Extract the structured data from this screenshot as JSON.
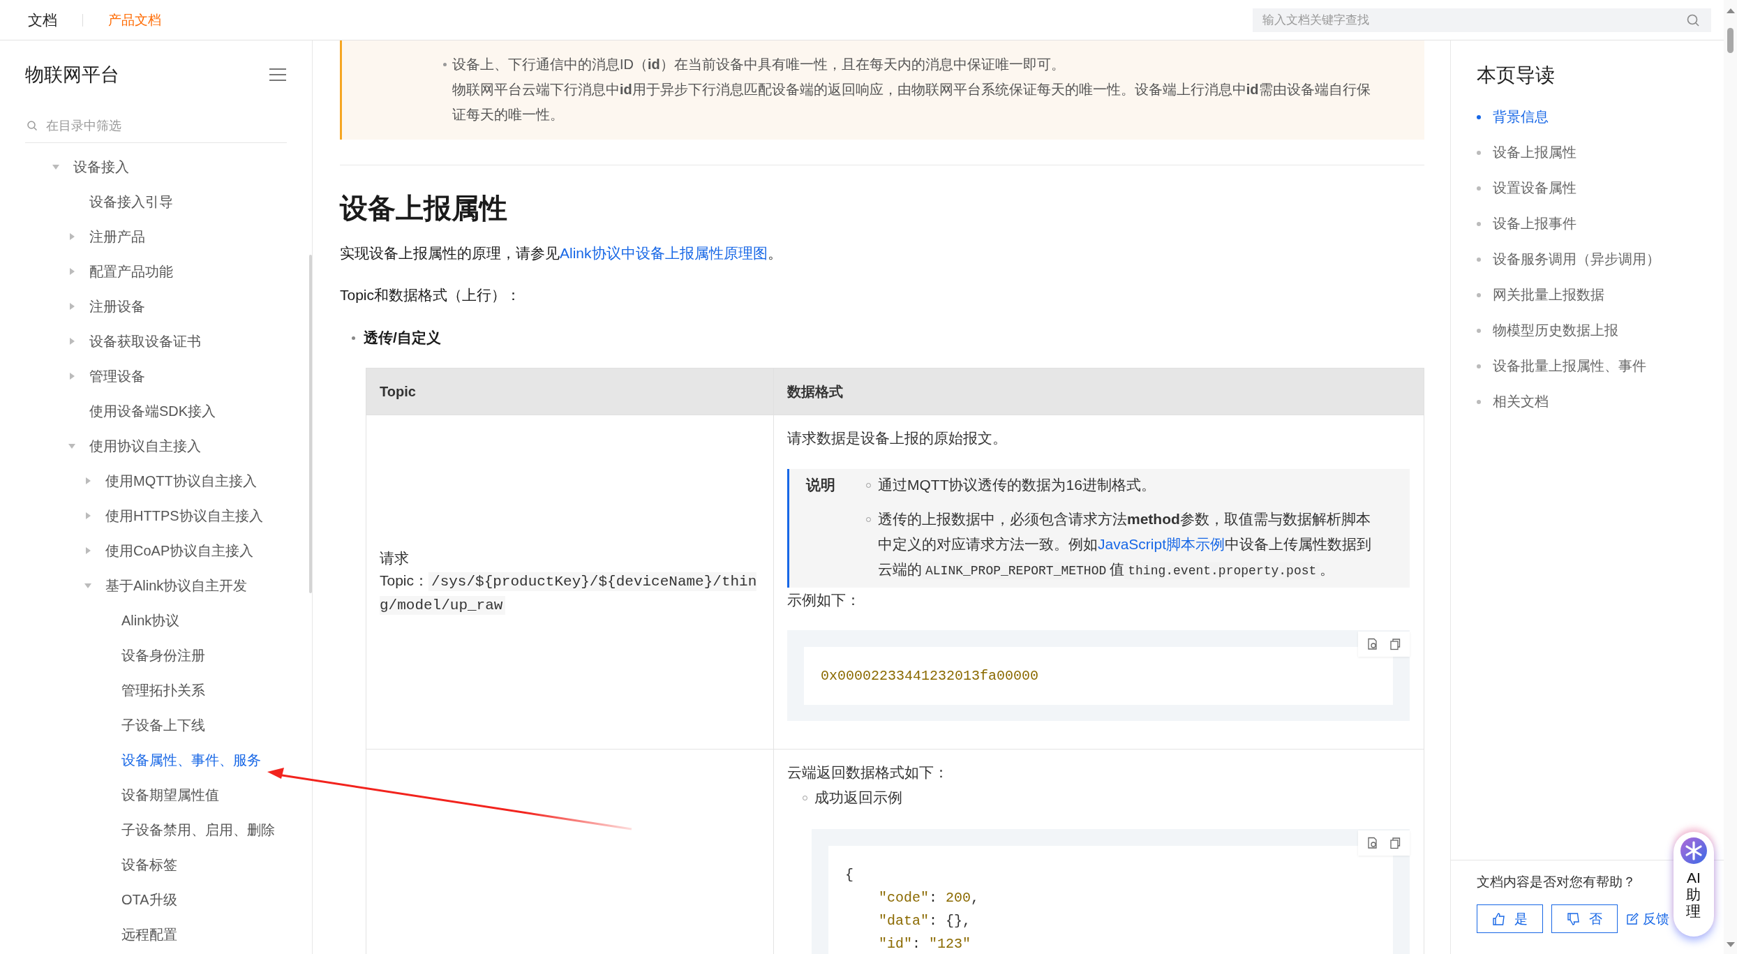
{
  "topbar": {
    "home": "文档",
    "section": "产品文档",
    "search": {
      "placeholder": "输入文档关键字查找"
    }
  },
  "sidebar": {
    "title": "物联网平台",
    "filter": {
      "placeholder": "在目录中筛选"
    },
    "tree": [
      {
        "label": "设备接入",
        "expanded": true,
        "selected": false,
        "children": [
          {
            "label": "设备接入引导",
            "selected": false
          },
          {
            "label": "注册产品",
            "expanded": false,
            "selected": false
          },
          {
            "label": "配置产品功能",
            "expanded": false,
            "selected": false
          },
          {
            "label": "注册设备",
            "expanded": false,
            "selected": false
          },
          {
            "label": "设备获取设备证书",
            "expanded": false,
            "selected": false
          },
          {
            "label": "管理设备",
            "expanded": false,
            "selected": false
          },
          {
            "label": "使用设备端SDK接入",
            "selected": false
          },
          {
            "label": "使用协议自主接入",
            "expanded": true,
            "selected": false,
            "children": [
              {
                "label": "使用MQTT协议自主接入",
                "expanded": false,
                "selected": false
              },
              {
                "label": "使用HTTPS协议自主接入",
                "expanded": false,
                "selected": false
              },
              {
                "label": "使用CoAP协议自主接入",
                "expanded": false,
                "selected": false
              },
              {
                "label": "基于Alink协议自主开发",
                "expanded": true,
                "selected": false,
                "children": [
                  {
                    "label": "Alink协议",
                    "selected": false
                  },
                  {
                    "label": "设备身份注册",
                    "selected": false
                  },
                  {
                    "label": "管理拓扑关系",
                    "selected": false
                  },
                  {
                    "label": "子设备上下线",
                    "selected": false
                  },
                  {
                    "label": "设备属性、事件、服务",
                    "selected": true
                  },
                  {
                    "label": "设备期望属性值",
                    "selected": false
                  },
                  {
                    "label": "子设备禁用、启用、删除",
                    "selected": false
                  },
                  {
                    "label": "设备标签",
                    "selected": false
                  },
                  {
                    "label": "OTA升级",
                    "selected": false
                  },
                  {
                    "label": "远程配置",
                    "selected": false
                  }
                ]
              }
            ]
          }
        ]
      }
    ]
  },
  "article": {
    "notice": {
      "items": [
        {
          "paragraphs": [
            "设备上、下行通信中的消息ID（**id**）在当前设备中具有唯一性，且在每天内的消息中保证唯一即可。",
            "物联网平台云端下行消息中**id**用于异步下行消息匹配设备端的返回响应，由物联网平台系统保证每天的唯一性。设备端上行消息中**id**需由设备端自行保证每天的唯一性。"
          ]
        }
      ]
    },
    "heading": "设备上报属性",
    "intro": [
      {
        "kind": "text",
        "text": "实现设备上报属性的原理，请参见"
      },
      {
        "kind": "link",
        "text": "Alink协议中设备上报属性原理图"
      },
      {
        "kind": "text",
        "text": "。"
      }
    ],
    "format_label": "Topic和数据格式（上行）：",
    "bullet": "透传/自定义",
    "table": {
      "columns": [
        "Topic",
        "数据格式"
      ],
      "rows": [
        {
          "left": {
            "label": "请求",
            "topic_label": "Topic：",
            "topic": "/sys/${productKey}/${deviceName}/thing/model/up_raw"
          },
          "right": [
            {
              "kind": "para",
              "parts": [
                {
                  "kind": "text",
                  "text": "请求数据是设备上报的原始报文。"
                }
              ]
            },
            {
              "kind": "note",
              "label": "说明",
              "items": [
                [
                  {
                    "kind": "text",
                    "text": "通过MQTT协议透传的数据为16进制格式。"
                  }
                ],
                [
                  {
                    "kind": "text",
                    "text": "透传的上报数据中，必须包含请求方法**method**参数，取值需与数据解析脚本中定义的对应请求方法一致。例如"
                  },
                  {
                    "kind": "link",
                    "text": "JavaScript脚本示例"
                  },
                  {
                    "kind": "text",
                    "text": "中设备上传属性数据到云端的"
                  },
                  {
                    "kind": "code",
                    "text": "ALINK_PROP_REPORT_METHOD"
                  },
                  {
                    "kind": "text",
                    "text": "值"
                  },
                  {
                    "kind": "code",
                    "text": "thing.event.property.post"
                  },
                  {
                    "kind": "text",
                    "text": "。"
                  }
                ]
              ]
            },
            {
              "kind": "para",
              "parts": [
                {
                  "kind": "text",
                  "text": "示例如下："
                }
              ]
            },
            {
              "kind": "code",
              "indent": false,
              "lines": [
                {
                  "nested": false,
                  "tokens": [
                    {
                      "kind": "number",
                      "text": "0x00002233441232013fa00000"
                    }
                  ]
                }
              ]
            }
          ]
        },
        {
          "right": [
            {
              "kind": "para",
              "parts": [
                {
                  "kind": "text",
                  "text": "云端返回数据格式如下："
                }
              ]
            },
            {
              "kind": "bullet",
              "text": "成功返回示例"
            },
            {
              "kind": "code",
              "indent": true,
              "lines": [
                {
                  "nested": false,
                  "tokens": [
                    {
                      "kind": "punct",
                      "text": "{"
                    }
                  ]
                },
                {
                  "nested": true,
                  "tokens": [
                    {
                      "kind": "string",
                      "text": "\"code\""
                    },
                    {
                      "kind": "punct",
                      "text": ": "
                    },
                    {
                      "kind": "number",
                      "text": "200"
                    },
                    {
                      "kind": "punct",
                      "text": ","
                    }
                  ]
                },
                {
                  "nested": true,
                  "tokens": [
                    {
                      "kind": "string",
                      "text": "\"data\""
                    },
                    {
                      "kind": "punct",
                      "text": ": {},"
                    }
                  ]
                },
                {
                  "nested": true,
                  "tokens": [
                    {
                      "kind": "string",
                      "text": "\"id\""
                    },
                    {
                      "kind": "punct",
                      "text": ": "
                    },
                    {
                      "kind": "string",
                      "text": "\"123\""
                    }
                  ]
                }
              ]
            }
          ]
        }
      ]
    }
  },
  "toc": {
    "title": "本页导读",
    "items": [
      {
        "label": "背景信息",
        "selected": true
      },
      {
        "label": "设备上报属性",
        "selected": false
      },
      {
        "label": "设置设备属性",
        "selected": false
      },
      {
        "label": "设备上报事件",
        "selected": false
      },
      {
        "label": "设备服务调用（异步调用）",
        "selected": false
      },
      {
        "label": "网关批量上报数据",
        "selected": false
      },
      {
        "label": "物模型历史数据上报",
        "selected": false
      },
      {
        "label": "设备批量上报属性、事件",
        "selected": false
      },
      {
        "label": "相关文档",
        "selected": false
      }
    ],
    "feedback": {
      "question": "文档内容是否对您有帮助？",
      "buttons": [
        {
          "kind": "like",
          "label": "是"
        },
        {
          "kind": "dislike",
          "label": "否"
        },
        {
          "kind": "feedback",
          "label": "反馈"
        }
      ]
    }
  },
  "assistant": {
    "label": "AI助理"
  }
}
